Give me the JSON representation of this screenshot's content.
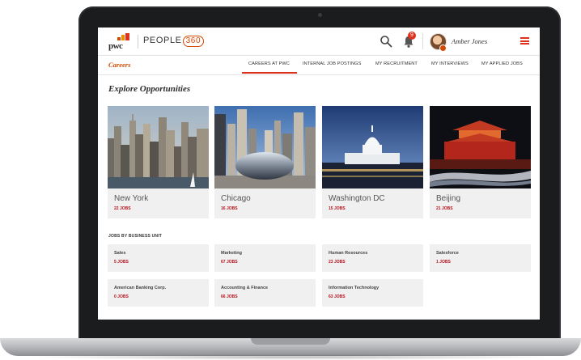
{
  "header": {
    "logo_text": "pwc",
    "brand_name": "PEOPLE",
    "brand_suffix": "360",
    "notification_count": "9",
    "user_name": "Amber Jones"
  },
  "subnav": {
    "section_title": "Careers",
    "tabs": [
      {
        "label": "CAREERS AT PWC",
        "active": true
      },
      {
        "label": "INTERNAL JOB POSTINGS",
        "active": false
      },
      {
        "label": "MY RECRUITMENT",
        "active": false
      },
      {
        "label": "MY INTERVIEWS",
        "active": false
      },
      {
        "label": "MY APPLIED JOBS",
        "active": false
      }
    ]
  },
  "main": {
    "heading": "Explore Opportunities",
    "cities": [
      {
        "name": "New York",
        "jobs": "22 JOBS"
      },
      {
        "name": "Chicago",
        "jobs": "16 JOBS"
      },
      {
        "name": "Washington DC",
        "jobs": "15 JOBS"
      },
      {
        "name": "Beijing",
        "jobs": "21 JOBS"
      }
    ],
    "business_units_heading": "JOBS BY BUSINESS UNIT",
    "business_units": [
      {
        "name": "Sales",
        "jobs": "5 JOBS"
      },
      {
        "name": "Marketing",
        "jobs": "67 JOBS"
      },
      {
        "name": "Human Resources",
        "jobs": "23 JOBS"
      },
      {
        "name": "Salesforce",
        "jobs": "1 JOBS"
      },
      {
        "name": "American Banking Corp.",
        "jobs": "0 JOBS"
      },
      {
        "name": "Accounting & Finance",
        "jobs": "66 JOBS"
      },
      {
        "name": "Information Technology",
        "jobs": "63 JOBS"
      }
    ]
  },
  "colors": {
    "accent": "#e0301e",
    "brand_orange": "#d04a02",
    "jobs_red": "#b5121b",
    "card_bg": "#f0f0f0"
  }
}
